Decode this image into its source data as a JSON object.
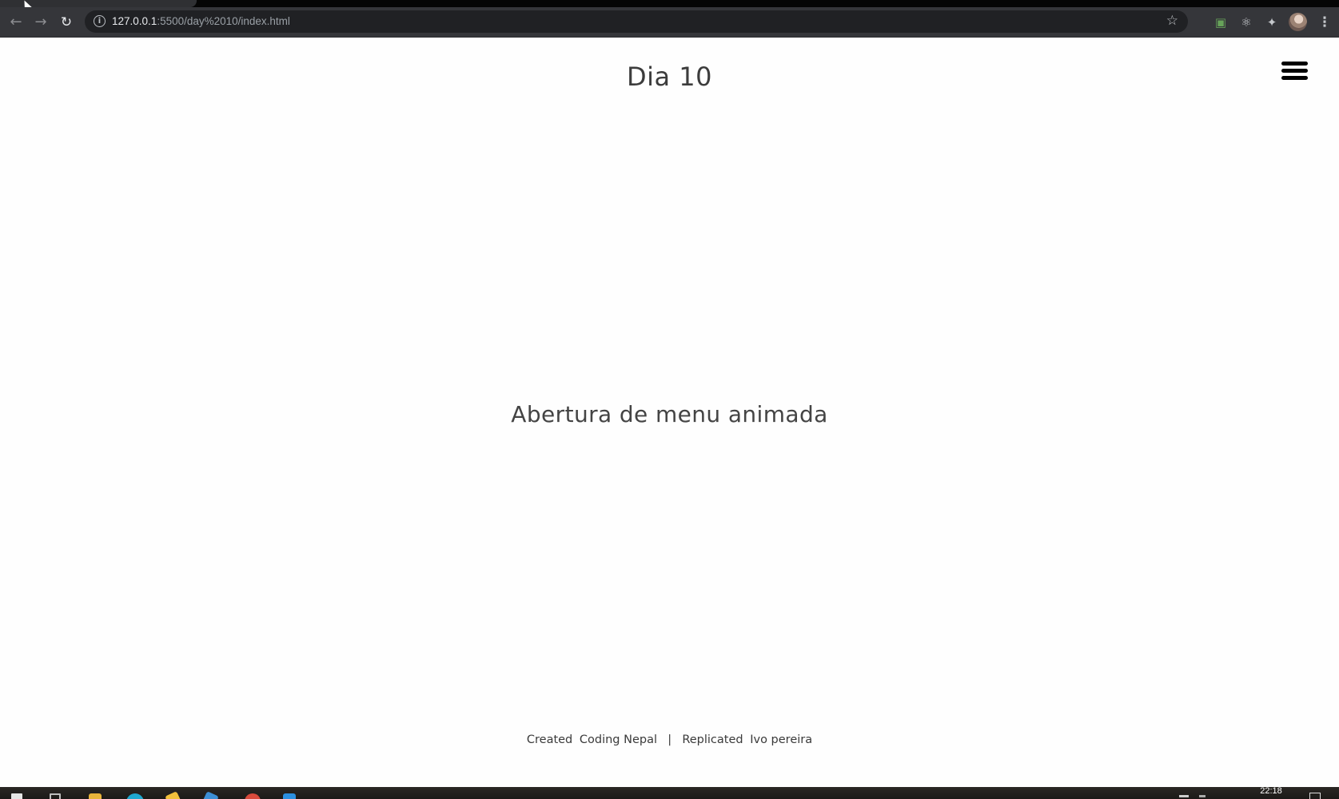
{
  "browser": {
    "url_host": "127.0.0.1",
    "url_rest": ":5500/day%2010/index.html",
    "icons": {
      "back": "arrow-left-icon",
      "forward": "arrow-right-icon",
      "reload": "reload-icon",
      "info": "info-icon",
      "bookmark": "star-icon",
      "cast": "cast-icon",
      "react_devtools": "react-icon",
      "extensions": "puzzle-icon",
      "profile": "avatar",
      "menu": "kebab-menu-icon"
    }
  },
  "page": {
    "title": "Dia 10",
    "heading": "Abertura de menu animada",
    "menu_icon": "hamburger-icon",
    "footer": {
      "created_label": "Created",
      "created_by": "Coding Nepal",
      "separator": "|",
      "replicated_label": "Replicated",
      "replicated_by": "Ivo pereira"
    }
  },
  "taskbar": {
    "clock": "22:18"
  }
}
